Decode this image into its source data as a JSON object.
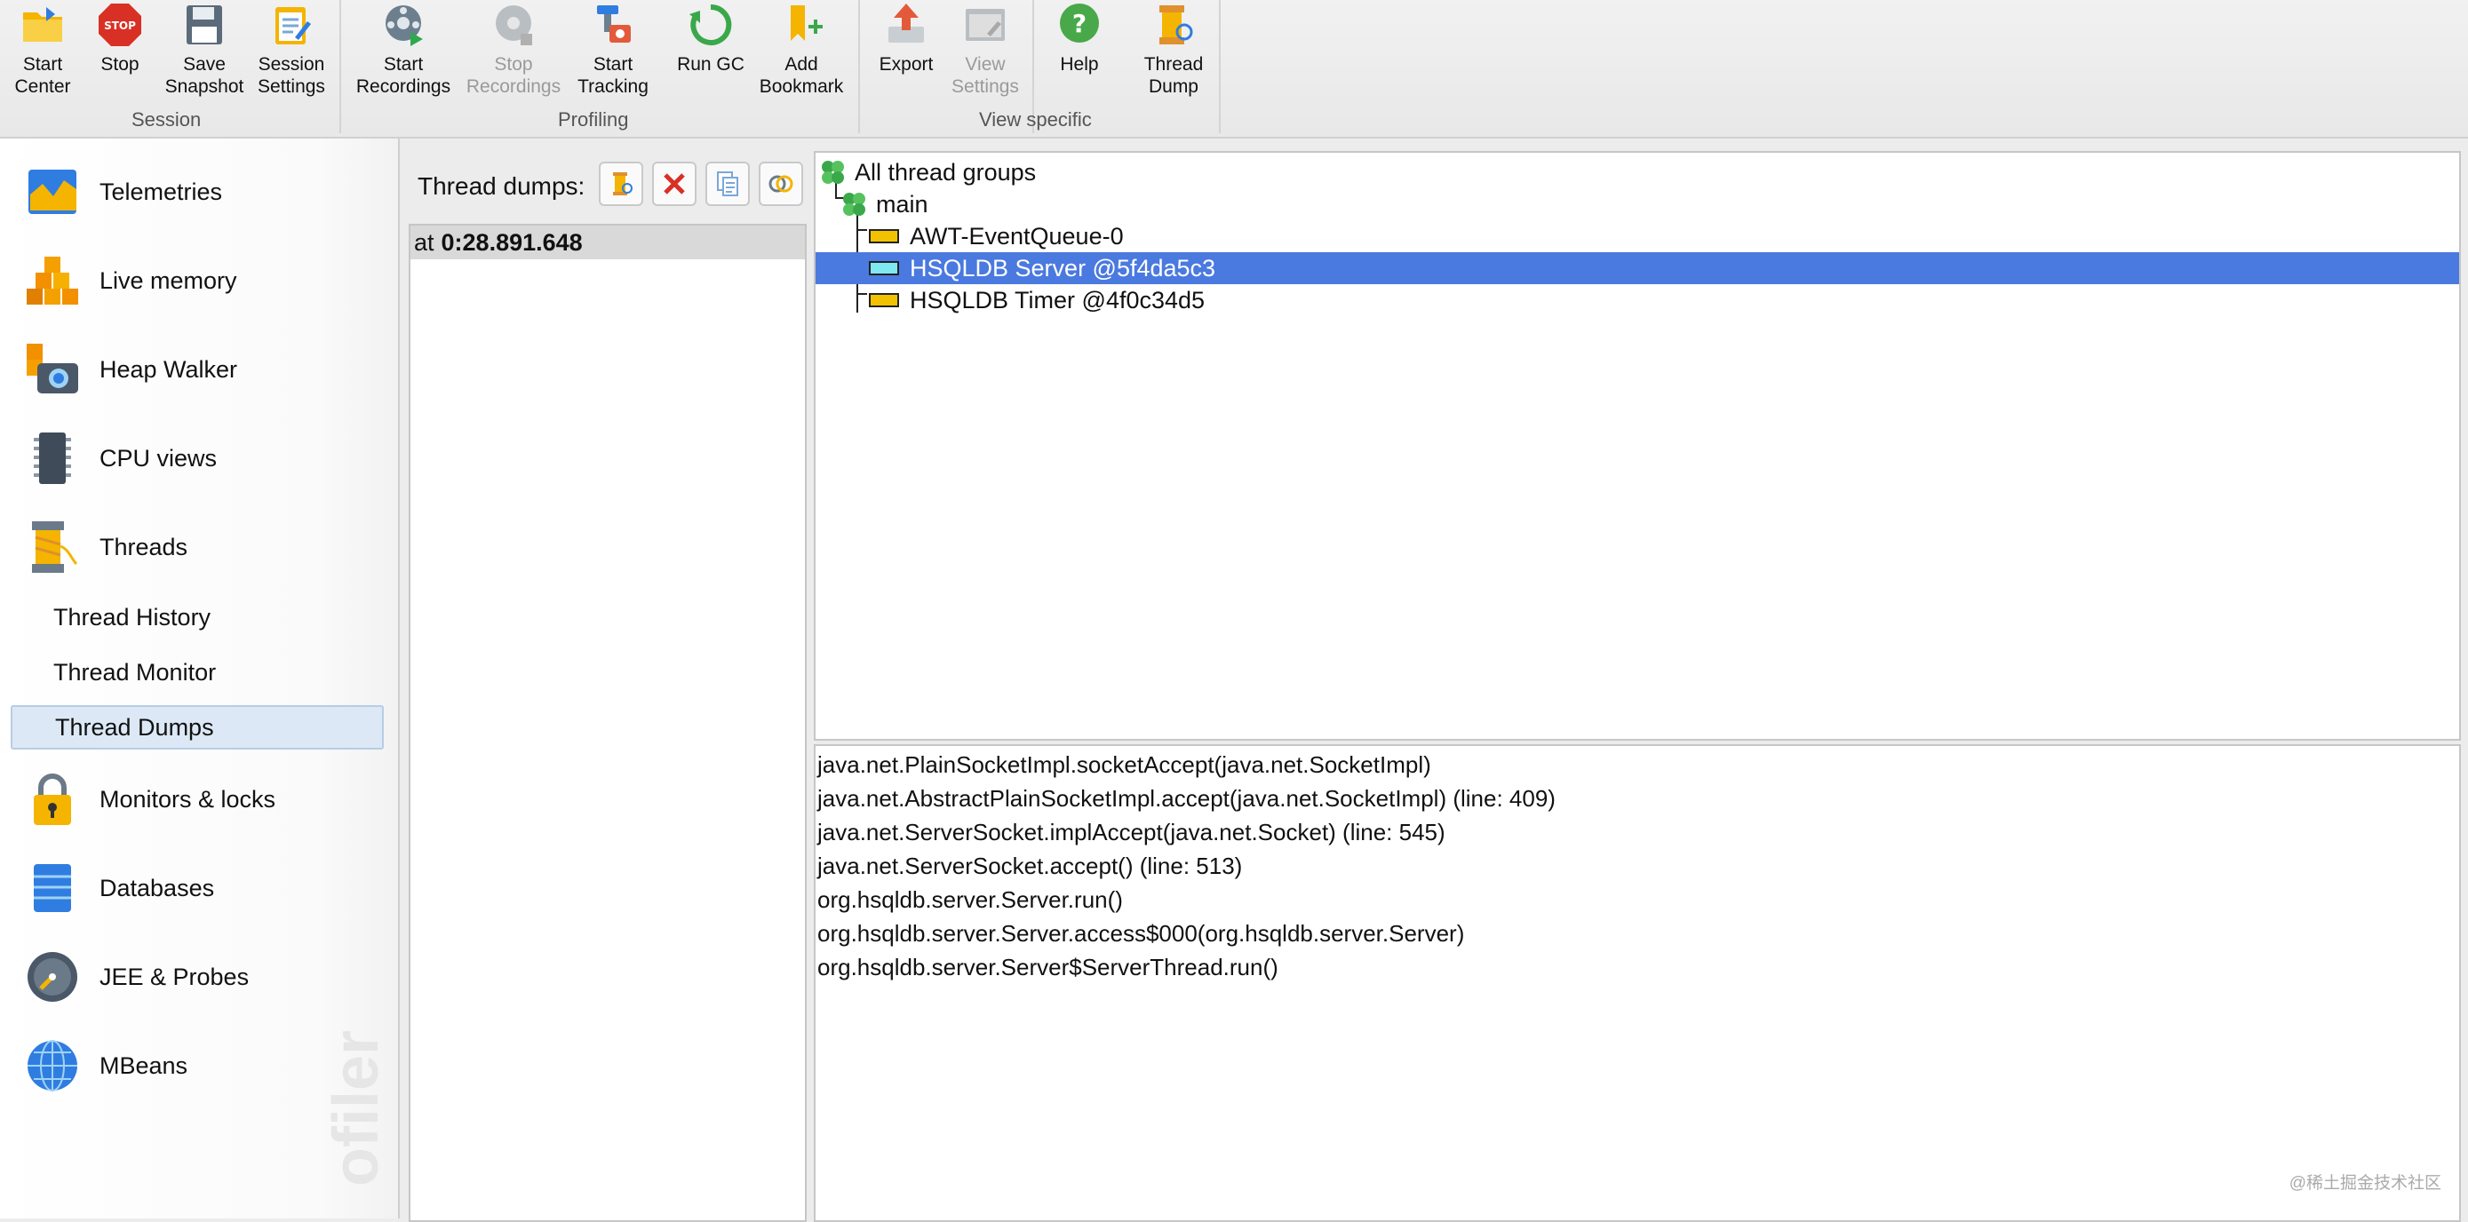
{
  "toolbar": {
    "groups": [
      {
        "title": "Session",
        "buttons": [
          {
            "label": "Start\nCenter",
            "icon": "folder-icon"
          },
          {
            "label": "Stop",
            "icon": "stop-sign-icon"
          },
          {
            "label": "Save\nSnapshot",
            "icon": "floppy-disk-icon"
          },
          {
            "label": "Session\nSettings",
            "icon": "settings-clipboard-icon"
          }
        ]
      },
      {
        "title": "Profiling",
        "buttons": [
          {
            "label": "Start\nRecordings",
            "icon": "record-start-icon"
          },
          {
            "label": "Stop\nRecordings",
            "icon": "record-stop-icon",
            "disabled": true
          },
          {
            "label": "Start\nTracking",
            "icon": "tracking-icon"
          },
          {
            "label": "Run GC",
            "icon": "recycle-icon"
          },
          {
            "label": "Add\nBookmark",
            "icon": "bookmark-add-icon"
          }
        ]
      },
      {
        "title": "View specific",
        "buttons": [
          {
            "label": "Export",
            "icon": "export-icon"
          },
          {
            "label": "View\nSettings",
            "icon": "view-settings-icon",
            "disabled": true
          },
          {
            "label": "Help",
            "icon": "help-icon"
          },
          {
            "label": "Thread\nDump",
            "icon": "thread-dump-icon"
          }
        ]
      }
    ]
  },
  "sidebar": {
    "items": [
      {
        "label": "Telemetries",
        "icon": "telemetries-icon"
      },
      {
        "label": "Live memory",
        "icon": "live-memory-icon"
      },
      {
        "label": "Heap Walker",
        "icon": "heap-walker-camera-icon"
      },
      {
        "label": "CPU views",
        "icon": "cpu-chip-icon"
      },
      {
        "label": "Threads",
        "icon": "threads-spool-icon"
      }
    ],
    "sub_items": [
      {
        "label": "Thread History"
      },
      {
        "label": "Thread Monitor"
      },
      {
        "label": "Thread Dumps",
        "selected": true
      }
    ],
    "items_after": [
      {
        "label": "Monitors & locks",
        "icon": "padlock-icon"
      },
      {
        "label": "Databases",
        "icon": "database-icon"
      },
      {
        "label": "JEE & Probes",
        "icon": "gauge-icon"
      },
      {
        "label": "MBeans",
        "icon": "globe-icon"
      }
    ],
    "watermark": "ofiler"
  },
  "dumps": {
    "label": "Thread dumps:",
    "entries": [
      {
        "prefix": "at",
        "time": "0:28.891.648"
      }
    ]
  },
  "tree": {
    "root": "All thread groups",
    "group": "main",
    "threads": [
      {
        "name": "AWT-EventQueue-0",
        "state_color": "#f2c200",
        "selected": false
      },
      {
        "name": "HSQLDB Server @5f4da5c3",
        "state_color": "#7fe8f0",
        "selected": true
      },
      {
        "name": "HSQLDB Timer @4f0c34d5",
        "state_color": "#f2c200",
        "selected": false
      }
    ]
  },
  "stack": [
    "java.net.PlainSocketImpl.socketAccept(java.net.SocketImpl)",
    "java.net.AbstractPlainSocketImpl.accept(java.net.SocketImpl) (line: 409)",
    "java.net.ServerSocket.implAccept(java.net.Socket) (line: 545)",
    "java.net.ServerSocket.accept() (line: 513)",
    "org.hsqldb.server.Server.run()",
    "org.hsqldb.server.Server.access$000(org.hsqldb.server.Server)",
    "org.hsqldb.server.Server$ServerThread.run()"
  ],
  "footer": "@稀土掘金技术社区",
  "colors": {
    "selection": "#4a79e0",
    "sub_selected_bg": "#dce8f5"
  }
}
